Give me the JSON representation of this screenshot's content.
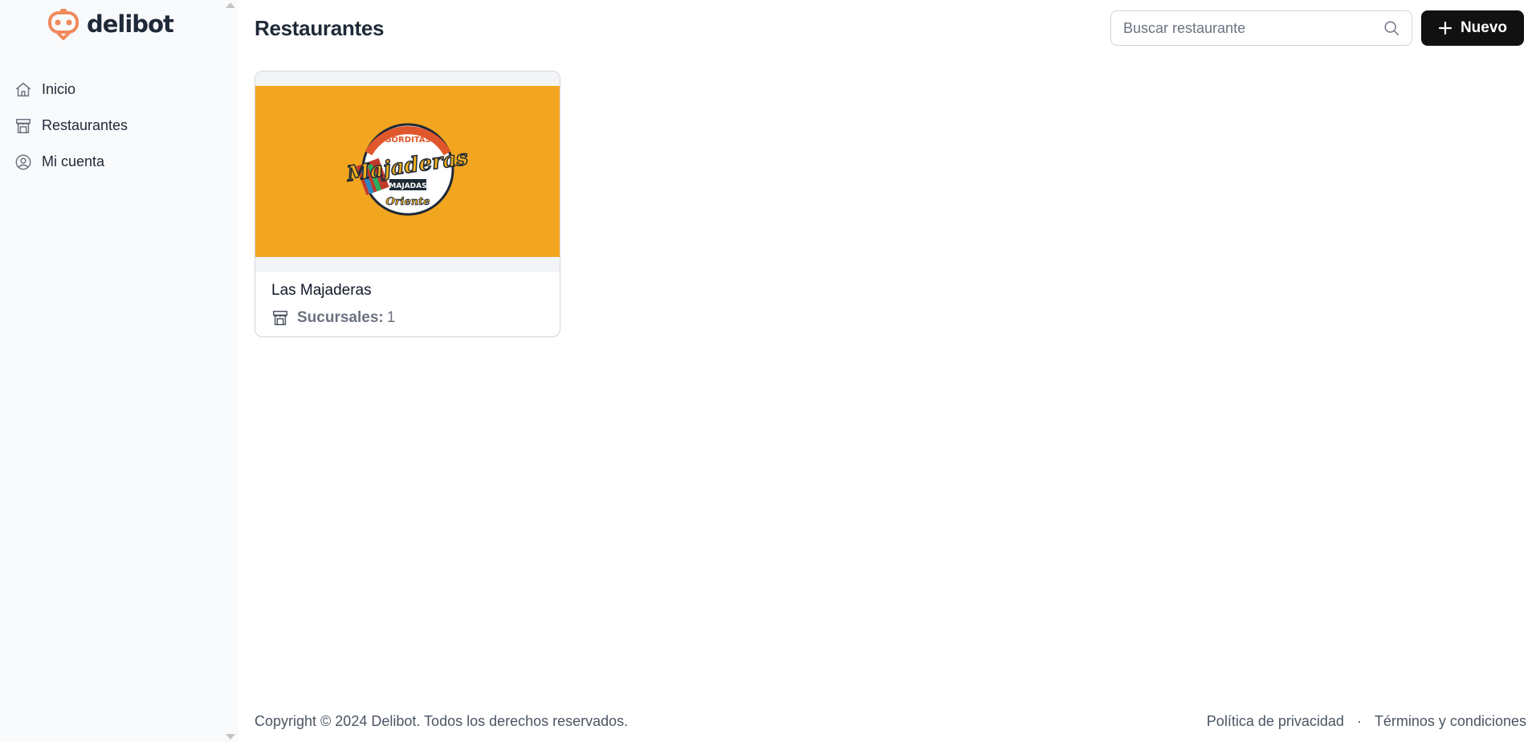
{
  "brand": {
    "name": "delibot",
    "color": "#f08a5d"
  },
  "sidebar": {
    "items": [
      {
        "label": "Inicio",
        "icon": "home-icon"
      },
      {
        "label": "Restaurantes",
        "icon": "store-icon"
      },
      {
        "label": "Mi cuenta",
        "icon": "user-circle-icon"
      }
    ]
  },
  "header": {
    "title": "Restaurantes",
    "search_placeholder": "Buscar restaurante",
    "search_value": "",
    "new_button_label": "Nuevo"
  },
  "restaurants": [
    {
      "name": "Las Majaderas",
      "branches_label": "Sucursales:",
      "branches_count": "1",
      "logo_text": {
        "top": "GORDITAS",
        "main": "Majaderas",
        "sub": "MAJADAS",
        "bottom": "Oriente"
      },
      "image_bg": "#f2a61f"
    }
  ],
  "footer": {
    "copyright": "Copyright © 2024 Delibot. Todos los derechos reservados.",
    "privacy": "Política de privacidad",
    "separator": "·",
    "terms": "Términos y condiciones"
  }
}
